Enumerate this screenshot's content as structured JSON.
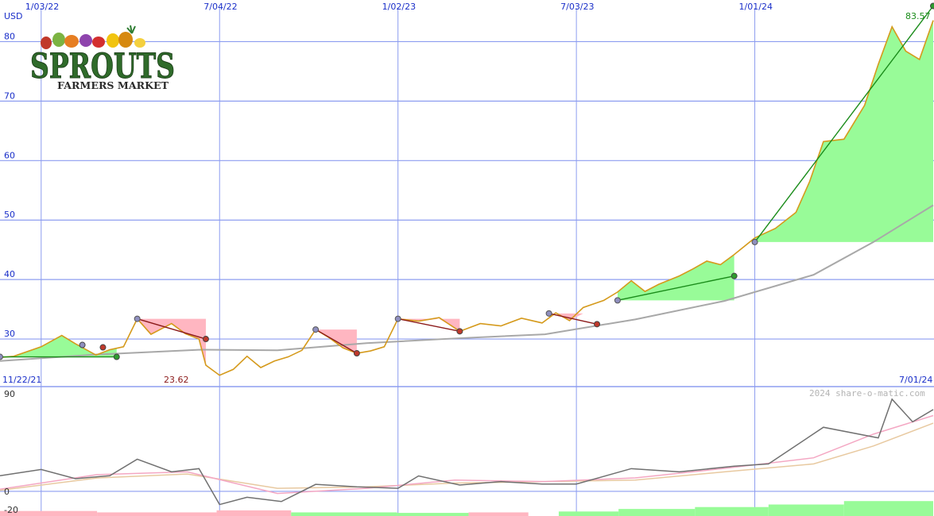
{
  "chart_data": [
    {
      "type": "line",
      "currency_label": "USD",
      "x_tick_labels": [
        "1/03/22",
        "7/04/22",
        "1/02/23",
        "7/03/23",
        "1/01/24"
      ],
      "range_start_label": "11/22/21",
      "range_end_label": "7/01/24",
      "y_tick_labels": [
        "30",
        "40",
        "50",
        "60",
        "70",
        "80"
      ],
      "ylim": [
        22,
        87
      ],
      "last_price_label": "83.57",
      "low_price_label": "23.62",
      "grid": true,
      "colors": {
        "price": "#d59a1c",
        "moving_average": "#a8a8a8",
        "up_fill": "#98fb98",
        "down_fill": "#ffb6c1",
        "up_trend": "#1a8c1a",
        "down_trend": "#8b1a1a",
        "grid": "#8d9df0"
      },
      "price_series": [
        {
          "d": "2021-11-22",
          "v": 26.9
        },
        {
          "d": "2021-12-06",
          "v": 27.1
        },
        {
          "d": "2022-01-03",
          "v": 28.7
        },
        {
          "d": "2022-01-24",
          "v": 30.6
        },
        {
          "d": "2022-02-07",
          "v": 29.2
        },
        {
          "d": "2022-02-28",
          "v": 27.3
        },
        {
          "d": "2022-03-14",
          "v": 28.2
        },
        {
          "d": "2022-03-28",
          "v": 28.7
        },
        {
          "d": "2022-04-11",
          "v": 33.4
        },
        {
          "d": "2022-04-25",
          "v": 30.8
        },
        {
          "d": "2022-05-16",
          "v": 32.6
        },
        {
          "d": "2022-05-30",
          "v": 30.9
        },
        {
          "d": "2022-06-13",
          "v": 30.0
        },
        {
          "d": "2022-06-20",
          "v": 25.6
        },
        {
          "d": "2022-07-04",
          "v": 23.9
        },
        {
          "d": "2022-07-18",
          "v": 24.9
        },
        {
          "d": "2022-08-01",
          "v": 27.1
        },
        {
          "d": "2022-08-15",
          "v": 25.2
        },
        {
          "d": "2022-08-29",
          "v": 26.3
        },
        {
          "d": "2022-09-12",
          "v": 27.0
        },
        {
          "d": "2022-09-26",
          "v": 28.1
        },
        {
          "d": "2022-10-10",
          "v": 31.6
        },
        {
          "d": "2022-10-24",
          "v": 30.2
        },
        {
          "d": "2022-11-07",
          "v": 28.5
        },
        {
          "d": "2022-11-21",
          "v": 27.6
        },
        {
          "d": "2022-12-05",
          "v": 28.0
        },
        {
          "d": "2022-12-19",
          "v": 28.7
        },
        {
          "d": "2023-01-02",
          "v": 33.4
        },
        {
          "d": "2023-01-23",
          "v": 33.0
        },
        {
          "d": "2023-02-13",
          "v": 33.6
        },
        {
          "d": "2023-03-06",
          "v": 31.3
        },
        {
          "d": "2023-03-27",
          "v": 32.6
        },
        {
          "d": "2023-04-17",
          "v": 32.2
        },
        {
          "d": "2023-05-08",
          "v": 33.5
        },
        {
          "d": "2023-05-29",
          "v": 32.7
        },
        {
          "d": "2023-06-12",
          "v": 34.4
        },
        {
          "d": "2023-06-26",
          "v": 33.1
        },
        {
          "d": "2023-07-10",
          "v": 35.3
        },
        {
          "d": "2023-07-31",
          "v": 36.5
        },
        {
          "d": "2023-08-14",
          "v": 37.9
        },
        {
          "d": "2023-08-28",
          "v": 39.8
        },
        {
          "d": "2023-09-11",
          "v": 38.0
        },
        {
          "d": "2023-09-25",
          "v": 39.2
        },
        {
          "d": "2023-10-16",
          "v": 40.6
        },
        {
          "d": "2023-10-30",
          "v": 41.8
        },
        {
          "d": "2023-11-13",
          "v": 43.1
        },
        {
          "d": "2023-11-27",
          "v": 42.5
        },
        {
          "d": "2023-12-11",
          "v": 44.2
        },
        {
          "d": "2024-01-01",
          "v": 47.0
        },
        {
          "d": "2024-01-22",
          "v": 48.6
        },
        {
          "d": "2024-02-12",
          "v": 51.3
        },
        {
          "d": "2024-02-26",
          "v": 56.5
        },
        {
          "d": "2024-03-11",
          "v": 63.2
        },
        {
          "d": "2024-04-01",
          "v": 63.6
        },
        {
          "d": "2024-04-22",
          "v": 69.3
        },
        {
          "d": "2024-05-06",
          "v": 76.2
        },
        {
          "d": "2024-05-20",
          "v": 82.5
        },
        {
          "d": "2024-06-03",
          "v": 78.4
        },
        {
          "d": "2024-06-17",
          "v": 77.0
        },
        {
          "d": "2024-07-01",
          "v": 83.57
        }
      ],
      "moving_average_series": [
        {
          "d": "2021-11-22",
          "v": 26.3
        },
        {
          "d": "2022-03-01",
          "v": 27.4
        },
        {
          "d": "2022-06-15",
          "v": 28.2
        },
        {
          "d": "2022-09-01",
          "v": 28.1
        },
        {
          "d": "2022-12-01",
          "v": 29.3
        },
        {
          "d": "2023-03-01",
          "v": 30.1
        },
        {
          "d": "2023-06-01",
          "v": 30.8
        },
        {
          "d": "2023-09-01",
          "v": 33.3
        },
        {
          "d": "2023-12-01",
          "v": 36.4
        },
        {
          "d": "2024-03-01",
          "v": 40.8
        },
        {
          "d": "2024-05-01",
          "v": 46.3
        },
        {
          "d": "2024-07-01",
          "v": 52.5
        }
      ],
      "trend_segments": [
        {
          "dir": "up",
          "start": {
            "d": "2021-11-22",
            "v": 27.0
          },
          "end": {
            "d": "2022-03-21",
            "v": 27.0
          }
        },
        {
          "dir": "down",
          "start": {
            "d": "2022-04-11",
            "v": 33.4
          },
          "end": {
            "d": "2022-06-20",
            "v": 30.0
          }
        },
        {
          "dir": "down",
          "start": {
            "d": "2022-10-10",
            "v": 31.6
          },
          "end": {
            "d": "2022-11-21",
            "v": 27.6
          }
        },
        {
          "dir": "down",
          "start": {
            "d": "2023-01-02",
            "v": 33.4
          },
          "end": {
            "d": "2023-03-06",
            "v": 31.3
          }
        },
        {
          "dir": "down",
          "start": {
            "d": "2023-06-05",
            "v": 34.3
          },
          "end": {
            "d": "2023-07-24",
            "v": 32.5
          }
        },
        {
          "dir": "up",
          "start": {
            "d": "2023-08-14",
            "v": 36.5
          },
          "end": {
            "d": "2023-12-11",
            "v": 40.6
          }
        },
        {
          "dir": "up",
          "start": {
            "d": "2024-01-01",
            "v": 46.3
          },
          "end": {
            "d": "2024-07-01",
            "v": 86.0
          }
        }
      ],
      "point_markers": [
        {
          "d": "2022-02-14",
          "v": 29.0
        },
        {
          "d": "2022-03-07",
          "v": 28.6
        }
      ]
    },
    {
      "type": "line",
      "watermark": "2024 share-o-matic.com",
      "y_tick_labels": [
        "90",
        "0",
        "-20"
      ],
      "ylim": [
        -23,
        97
      ],
      "colors": {
        "oscillator": "#707070",
        "fast_average": "#f4a7c3",
        "slow_average": "#e8c9a0",
        "pos_bars": "#98fb98",
        "neg_bars": "#ffb6c1"
      },
      "oscillator_series": [
        {
          "d": "2021-11-22",
          "v": 14.6
        },
        {
          "d": "2022-01-03",
          "v": 20.4
        },
        {
          "d": "2022-02-07",
          "v": 11.8
        },
        {
          "d": "2022-03-14",
          "v": 14.6
        },
        {
          "d": "2022-04-11",
          "v": 30.0
        },
        {
          "d": "2022-05-16",
          "v": 18.2
        },
        {
          "d": "2022-06-13",
          "v": 21.2
        },
        {
          "d": "2022-07-04",
          "v": -12.3
        },
        {
          "d": "2022-08-01",
          "v": -5.5
        },
        {
          "d": "2022-09-05",
          "v": -9.5
        },
        {
          "d": "2022-10-10",
          "v": 6.5
        },
        {
          "d": "2022-11-21",
          "v": 4.2
        },
        {
          "d": "2023-01-02",
          "v": 2.8
        },
        {
          "d": "2023-01-23",
          "v": 14.4
        },
        {
          "d": "2023-03-06",
          "v": 5.9
        },
        {
          "d": "2023-04-17",
          "v": 9.1
        },
        {
          "d": "2023-05-29",
          "v": 6.8
        },
        {
          "d": "2023-07-03",
          "v": 6.8
        },
        {
          "d": "2023-08-28",
          "v": 21.2
        },
        {
          "d": "2023-10-16",
          "v": 18.2
        },
        {
          "d": "2023-12-11",
          "v": 23.5
        },
        {
          "d": "2024-01-15",
          "v": 25.6
        },
        {
          "d": "2024-03-11",
          "v": 59.8
        },
        {
          "d": "2024-05-06",
          "v": 49.9
        },
        {
          "d": "2024-05-20",
          "v": 86.0
        },
        {
          "d": "2024-06-10",
          "v": 64.9
        },
        {
          "d": "2024-07-01",
          "v": 76.3
        }
      ],
      "fast_average_series": [
        {
          "d": "2021-11-22",
          "v": 2.0
        },
        {
          "d": "2022-03-01",
          "v": 15.6
        },
        {
          "d": "2022-06-01",
          "v": 18.2
        },
        {
          "d": "2022-09-01",
          "v": -2.0
        },
        {
          "d": "2022-12-01",
          "v": 2.8
        },
        {
          "d": "2023-03-01",
          "v": 10.5
        },
        {
          "d": "2023-06-01",
          "v": 9.1
        },
        {
          "d": "2023-09-01",
          "v": 12.6
        },
        {
          "d": "2023-12-01",
          "v": 21.4
        },
        {
          "d": "2024-03-01",
          "v": 31.3
        },
        {
          "d": "2024-05-01",
          "v": 53.4
        },
        {
          "d": "2024-07-01",
          "v": 70.7
        }
      ],
      "slow_average_series": [
        {
          "d": "2021-11-22",
          "v": 1.0
        },
        {
          "d": "2022-03-01",
          "v": 12.5
        },
        {
          "d": "2022-06-01",
          "v": 16.2
        },
        {
          "d": "2022-09-01",
          "v": 2.8
        },
        {
          "d": "2022-12-01",
          "v": 4.2
        },
        {
          "d": "2023-03-01",
          "v": 7.7
        },
        {
          "d": "2023-06-01",
          "v": 9.1
        },
        {
          "d": "2023-09-01",
          "v": 10.5
        },
        {
          "d": "2023-12-01",
          "v": 18.2
        },
        {
          "d": "2024-03-01",
          "v": 25.6
        },
        {
          "d": "2024-05-01",
          "v": 42.3
        },
        {
          "d": "2024-07-01",
          "v": 63.6
        }
      ],
      "momentum_bars": [
        {
          "start": "2021-11-22",
          "end": "2022-03-01",
          "v": -2.7
        },
        {
          "start": "2022-03-01",
          "end": "2022-07-01",
          "v": -1.6
        },
        {
          "start": "2022-07-01",
          "end": "2022-09-15",
          "v": -3.2
        },
        {
          "start": "2022-09-15",
          "end": "2023-01-01",
          "v": 1.6
        },
        {
          "start": "2023-01-01",
          "end": "2023-03-15",
          "v": 1.2
        },
        {
          "start": "2023-03-15",
          "end": "2023-05-15",
          "v": -1.6
        },
        {
          "start": "2023-06-15",
          "end": "2023-08-15",
          "v": 2.3
        },
        {
          "start": "2023-08-15",
          "end": "2023-11-01",
          "v": 4.3
        },
        {
          "start": "2023-11-01",
          "end": "2024-01-15",
          "v": 5.8
        },
        {
          "start": "2024-01-15",
          "end": "2024-04-01",
          "v": 7.8
        },
        {
          "start": "2024-04-01",
          "end": "2024-07-01",
          "v": 10.5
        }
      ]
    }
  ],
  "logo": {
    "wordmark": "SPROUTS",
    "subtitle": "FARMERS MARKET",
    "brand_color": "#2f6b2a"
  }
}
